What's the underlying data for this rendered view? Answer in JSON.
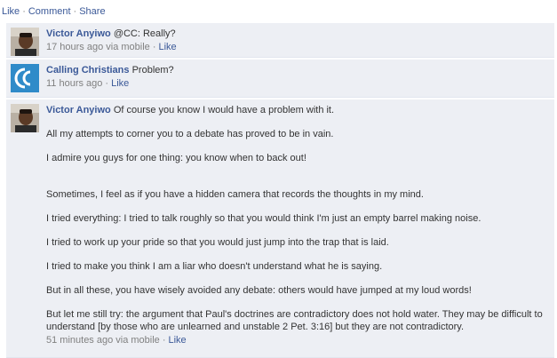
{
  "top_actions": {
    "like": "Like",
    "comment": "Comment",
    "share": "Share",
    "separator": "·"
  },
  "comments": [
    {
      "author": "Victor Anyiwo",
      "text": "@CC: Really?",
      "time": "17 hours ago",
      "via": "via mobile",
      "like": "Like",
      "separator": "·"
    },
    {
      "author": "Calling Christians",
      "text": "Problem?",
      "time": "11 hours ago",
      "like": "Like",
      "separator": "·"
    },
    {
      "author": "Victor Anyiwo",
      "text": "Of course you know I would have a problem with it.",
      "paragraphs": [
        "All my attempts to corner you to a debate has proved to be in vain.",
        "I admire you guys for one thing: you know when to back out!",
        "Sometimes, I feel as if you have a hidden camera that records the thoughts in my mind.",
        "I tried everything: I tried to talk roughly so that you would think I'm just an empty barrel making noise.",
        "I tried to work up your pride so that you would just jump into the trap that is laid.",
        "I tried to make you think I am a liar who doesn't understand what he is saying.",
        "But in all these, you have wisely avoided any debate: others would have jumped at my loud words!",
        "But let me still try: the argument that Paul's doctrines are contradictory does not hold water. They may be difficult to understand [by those who are unlearned and unstable 2 Pet. 3:16] but they are not contradictory."
      ],
      "time": "51 minutes ago",
      "via": "via mobile",
      "like": "Like",
      "separator": "·"
    }
  ],
  "colors": {
    "link": "#3b5998",
    "comment_bg": "#edeff4",
    "muted": "#808080",
    "text": "#333333"
  }
}
